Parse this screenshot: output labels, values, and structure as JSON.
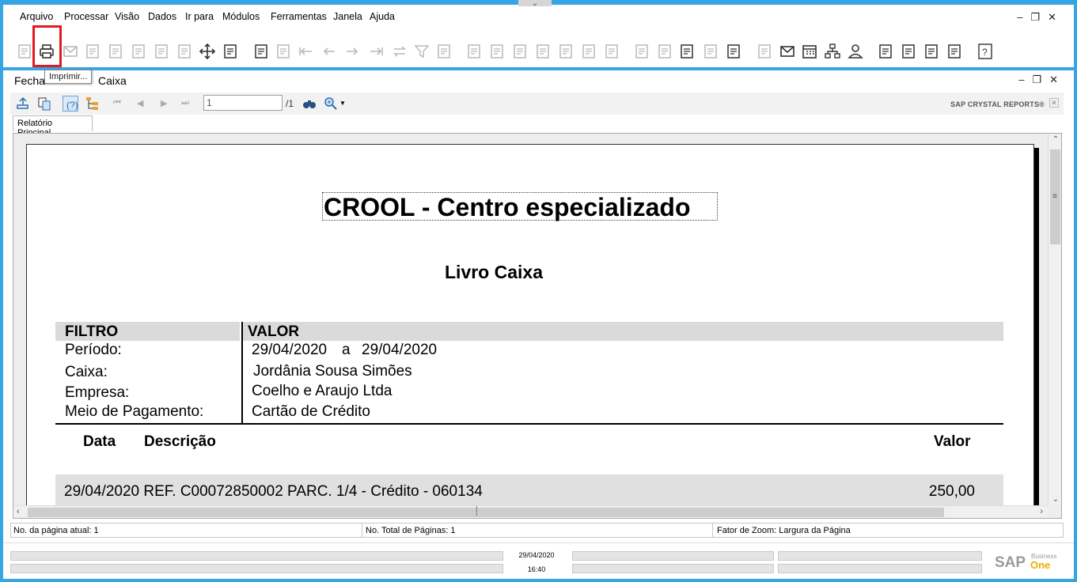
{
  "menu": {
    "items": [
      "Arquivo",
      "Processar",
      "Visão",
      "Dados",
      "Ir para",
      "Módulos",
      "Ferramentas",
      "Janela",
      "Ajuda"
    ]
  },
  "toolbar": {
    "tooltip": "Imprimir...",
    "highlighted_icon": "printer-icon",
    "highlight_color": "#e11a22",
    "icons": [
      "preview-icon",
      "printer-icon",
      "email-icon",
      "sms-icon",
      "fax-icon",
      "excel-icon",
      "word-icon",
      "pdf-icon",
      "move-icon",
      "lock-form-icon",
      "find-icon",
      "add-icon",
      "first-record-icon",
      "previous-record-icon",
      "next-record-icon",
      "last-record-icon",
      "refresh-icon",
      "filter-icon",
      "sort-icon",
      "base-document-icon",
      "target-document-icon",
      "payment-icon",
      "payment-means-icon",
      "balance-icon",
      "journal-icon",
      "gross-profit-icon",
      "edit-icon",
      "settings-icon",
      "layout-designer-icon",
      "message-icon",
      "alerts-icon",
      "activity-icon",
      "mail-icon",
      "calendar-icon",
      "org-chart-icon",
      "user-icon",
      "docs-icon",
      "widgets-icon",
      "export-icon",
      "edit-document-icon",
      "help-icon"
    ]
  },
  "window": {
    "title_part1": "Fecha",
    "title_part2": "Caixa"
  },
  "crystal": {
    "page_input": "1",
    "page_total": "/1",
    "brand": "SAP CRYSTAL REPORTS®",
    "tab": "Relatório Principal"
  },
  "report": {
    "company": "CROOL - Centro especializado",
    "title": "Livro Caixa",
    "filter_header": "FILTRO",
    "value_header": "VALOR",
    "filters": [
      {
        "label": "Período:",
        "value_from": "29/04/2020",
        "connector": "a",
        "value_to": "29/04/2020"
      },
      {
        "label": "Caixa:",
        "value": "Jordânia Sousa Simões"
      },
      {
        "label": "Empresa:",
        "value": "Coelho e Araujo Ltda"
      },
      {
        "label": "Meio de Pagamento:",
        "value": "Cartão de Crédito"
      }
    ],
    "columns": {
      "date": "Data",
      "description": "Descrição",
      "amount": "Valor"
    },
    "rows": [
      {
        "description": "29/04/2020 REF. C00072850002 PARC. 1/4 - Crédito - 060134",
        "amount": "250,00"
      }
    ]
  },
  "viewer_status": {
    "current_page": "No. da página atual: 1",
    "total_pages": "No. Total de Páginas: 1",
    "zoom": "Fator de Zoom: Largura da Página"
  },
  "app_status": {
    "date": "29/04/2020",
    "time": "16:40",
    "logo_main": "SAP",
    "logo_sub": "Business",
    "logo_one": "One"
  },
  "colors": {
    "frame": "#35a6e3",
    "filter_header_bg": "#dadada",
    "row_bg": "#e0e0e0",
    "logo_accent": "#f0ab00"
  }
}
